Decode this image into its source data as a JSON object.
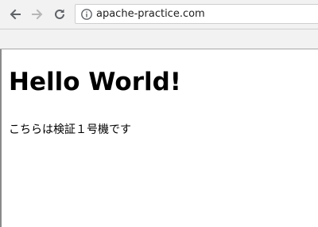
{
  "browser": {
    "address_bar": {
      "url": "apache-practice.com",
      "security_icon": "info-icon"
    },
    "nav": {
      "back_icon": "arrow-left-icon",
      "forward_icon": "arrow-right-icon",
      "reload_icon": "reload-icon"
    }
  },
  "page": {
    "heading": "Hello World!",
    "body_text": "こちらは検証１号機です"
  }
}
